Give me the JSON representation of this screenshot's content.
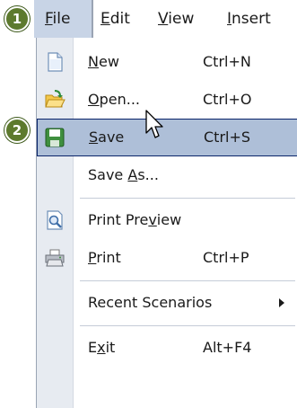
{
  "menubar": {
    "file": {
      "key": "F",
      "rest": "ile"
    },
    "edit": {
      "key": "E",
      "rest": "dit"
    },
    "view": {
      "key": "V",
      "rest": "iew"
    },
    "insert": {
      "key": "I",
      "rest": "nsert"
    }
  },
  "markers": {
    "one": "1",
    "two": "2"
  },
  "menu": {
    "new": {
      "key": "N",
      "rest": "ew",
      "shortcut": "Ctrl+N",
      "icon": "new-document-icon"
    },
    "open": {
      "key": "O",
      "rest": "pen...",
      "shortcut": "Ctrl+O",
      "icon": "open-folder-icon"
    },
    "save": {
      "key": "S",
      "rest": "ave",
      "shortcut": "Ctrl+S",
      "icon": "save-disk-icon"
    },
    "save_as": {
      "pre": "Save ",
      "key": "A",
      "rest": "s...",
      "shortcut": ""
    },
    "print_preview": {
      "pre": "Print Pre",
      "key": "v",
      "rest": "iew",
      "icon": "print-preview-icon"
    },
    "print": {
      "key": "P",
      "rest": "rint",
      "shortcut": "Ctrl+P",
      "icon": "printer-icon"
    },
    "recent": {
      "label": "Recent Scenarios"
    },
    "exit": {
      "pre": "E",
      "key": "x",
      "rest": "it",
      "shortcut": "Alt+F4"
    }
  },
  "colors": {
    "highlight": "#aebfd8",
    "highlight_border": "#0a246a",
    "marker": "#5d7a2e",
    "gutter": "#e7ebf1"
  }
}
